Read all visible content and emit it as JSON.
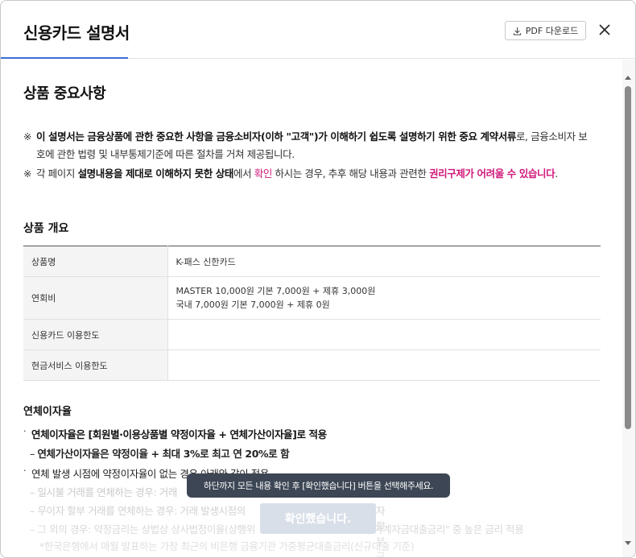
{
  "header": {
    "title": "신용카드 설명서",
    "pdf_label": "PDF 다운로드"
  },
  "section": {
    "title": "상품 중요사항"
  },
  "notices": [
    {
      "mark": "※",
      "bold_prefix": "이 설명서는 금융상품에 관한 중요한 사항을 금융소비자(이하 \"고객\")가 이해하기 쉽도록 설명하기 위한 중요 계약서류",
      "rest": "로, 금융소비자 보호에 관한 법령 및 내부통제기준에 따른 절차를 거쳐 제공됩니다."
    },
    {
      "mark": "※",
      "p1": "각 페이지 ",
      "p2": "설명내용을 제대로 이해하지 못한 상태",
      "p3": "에서 ",
      "p4": "확인",
      "p5": " 하시는 경우, 추후 해당 내용과 관련한 ",
      "p6": "권리구제가 어려울 수 있습니다",
      "p7": "."
    }
  ],
  "overview": {
    "title": "상품 개요",
    "rows": [
      {
        "label": "상품명",
        "value_lines": [
          "K-패스 신한카드"
        ]
      },
      {
        "label": "연회비",
        "value_lines": [
          "MASTER 10,000원 기본 7,000원 + 제휴 3,000원",
          "국내 7,000원 기본 7,000원 + 제휴 0원"
        ]
      },
      {
        "label": "신용카드 이용한도",
        "value_lines": [
          ""
        ]
      },
      {
        "label": "현금서비스 이용한도",
        "value_lines": [
          ""
        ]
      }
    ]
  },
  "late": {
    "title": "연체이자율",
    "b1": "연체이자율은 [회원별·이용상품별 약정이자율 + 연체가산이자율]로 적용",
    "d1": "연체가산이자율은 약정이율 + 최대 3%로 최고 연 20%로 함",
    "b2": "연체 발생 시점에 약정이자율이 없는 경우 아래와 같이 적용",
    "d2": "일시불 거래를 연체하는 경우: 거래",
    "d2b": "발생시점의",
    "d3": "무이자 할부 거래를 연체하는 경우: 거래 발생시점의",
    "d3b": "자 할부금리",
    "d4": "그 외의 경우: 약정금리는 상법상 상사법정이율(상행위",
    "d4b": "금융가계자금대출금리\" 중 높은 금리 적용",
    "d5": "*한국은행에서 매월 발표하는 가장 최근의 비은행 금융기관 가중평균대출금리(신규대출 기준)"
  },
  "tooltip": "하단까지 모든 내용 확인 후 [확인했습니다] 버튼을 선택해주세요.",
  "confirm_label": "확인했습니다.",
  "colors": {
    "accent": "#3b6fd8",
    "highlight": "#d0187a",
    "tooltip_bg": "#3d4654",
    "disabled_btn": "#d9dfe8"
  }
}
